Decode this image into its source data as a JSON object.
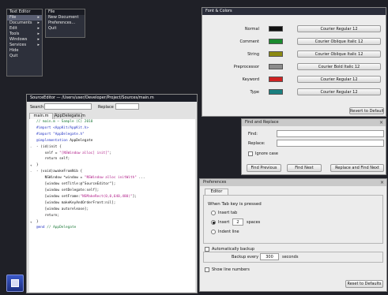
{
  "menus": {
    "root": {
      "title": "Text Editor",
      "items": [
        {
          "label": "File",
          "selected": true
        },
        {
          "label": "Documents"
        },
        {
          "label": "Edit"
        },
        {
          "label": "Tools"
        },
        {
          "label": "Windows"
        },
        {
          "label": "Services"
        },
        {
          "label": "Hide"
        },
        {
          "label": "Quit"
        }
      ]
    },
    "file": {
      "title": "File",
      "items": [
        {
          "label": "New Document"
        },
        {
          "label": "Preferences..."
        },
        {
          "label": "Quit"
        }
      ]
    }
  },
  "font_colors": {
    "title": "Font & Colors",
    "rows": [
      {
        "label": "Normal",
        "color": "#111111",
        "button": "Courier Regular 12"
      },
      {
        "label": "Comment",
        "color": "#1a8a2e",
        "button": "Courier Oblique Italic 12"
      },
      {
        "label": "String",
        "color": "#8c8a12",
        "button": "Courier Oblique Italic 12"
      },
      {
        "label": "Preprocessor",
        "color": "#8c8c8c",
        "button": "Courier Bold Italic 12"
      },
      {
        "label": "Keyword",
        "color": "#cf2222",
        "button": "Courier Regular 12"
      },
      {
        "label": "Type",
        "color": "#1a7f7f",
        "button": "Courier Regular 12"
      }
    ],
    "revert_label": "Revert to Default"
  },
  "editor": {
    "title": "SourceEditor — /Users/user/Developer/Project/Sources/main.m",
    "search_label": "Search",
    "replace_label": "Replace",
    "tabs": [
      "main.m",
      "AppDelegate.m"
    ],
    "lines": [
      {
        "parts": [
          {
            "t": "// main.m — Sample (C) 2010",
            "c": "cm"
          }
        ]
      },
      {
        "parts": [
          {
            "t": ""
          }
        ]
      },
      {
        "parts": [
          {
            "t": "#import <AppKit/AppKit.h>",
            "c": "kw"
          }
        ]
      },
      {
        "parts": [
          {
            "t": "#import \"AppDelegate.h\"",
            "c": "kw"
          }
        ]
      },
      {
        "parts": [
          {
            "t": ""
          }
        ]
      },
      {
        "parts": [
          {
            "t": "@implementation ",
            "c": "kw"
          },
          {
            "t": "AppDelegate"
          }
        ]
      },
      {
        "parts": [
          {
            "t": ""
          }
        ]
      },
      {
        "fold": "-",
        "parts": [
          {
            "t": "- (id)init {"
          }
        ]
      },
      {
        "parts": [
          {
            "t": ""
          }
        ]
      },
      {
        "parts": [
          {
            "t": "    self = "
          },
          {
            "t": "\"[NSWindow alloc] init]\"",
            "c": "st"
          },
          {
            "t": ";"
          }
        ]
      },
      {
        "parts": [
          {
            "t": "    return self;"
          }
        ]
      },
      {
        "fold": "+",
        "parts": [
          {
            "t": "}"
          }
        ]
      },
      {
        "parts": [
          {
            "t": ""
          }
        ]
      },
      {
        "fold": "-",
        "parts": [
          {
            "t": "- (void)awakeFromNib {"
          }
        ]
      },
      {
        "parts": [
          {
            "t": ""
          }
        ]
      },
      {
        "parts": [
          {
            "t": "    NSWindow *window = "
          },
          {
            "t": "\"NSWindow alloc initWith\"",
            "c": "st"
          },
          {
            "t": " ..."
          }
        ]
      },
      {
        "parts": [
          {
            "t": ""
          }
        ]
      },
      {
        "parts": [
          {
            "t": "    [window setTitle:@\"SourceEditor\"];"
          }
        ]
      },
      {
        "parts": [
          {
            "t": "    [window setDelegate:self];"
          }
        ]
      },
      {
        "parts": [
          {
            "t": "    [window setFrame:"
          },
          {
            "t": "\"NSMakeRect(0,0,640,480)\"",
            "c": "st"
          },
          {
            "t": "];"
          }
        ]
      },
      {
        "parts": [
          {
            "t": "    [window makeKeyAndOrderFront:nil];"
          }
        ]
      },
      {
        "parts": [
          {
            "t": ""
          }
        ]
      },
      {
        "parts": [
          {
            "t": "    [window autorelease];"
          }
        ]
      },
      {
        "parts": [
          {
            "t": "    return;"
          }
        ]
      },
      {
        "fold": "+",
        "parts": [
          {
            "t": "}"
          }
        ]
      },
      {
        "parts": [
          {
            "t": ""
          }
        ]
      },
      {
        "parts": [
          {
            "t": "@end ",
            "c": "kw"
          },
          {
            "t": "// AppDelegate",
            "c": "cm"
          }
        ]
      }
    ]
  },
  "find_replace": {
    "title": "Find and Replace",
    "find_label": "Find:",
    "replace_label": "Replace:",
    "ignore_case": "Ignore case",
    "buttons": [
      "Find Previous",
      "Find Next",
      "Replace and Find Next"
    ]
  },
  "preferences": {
    "title": "Preferences",
    "tab": "Editor",
    "tab_label": "When Tab key is pressed",
    "opt_tab": "Insert tab",
    "opt_spaces_pre": "Insert",
    "opt_spaces_value": "2",
    "opt_spaces_post": "spaces",
    "opt_indent": "Indent line",
    "auto_backup": "Automatically backup",
    "backup_every_pre": "Backup every",
    "backup_every_value": "300",
    "backup_every_post": "seconds",
    "show_line_numbers": "Show line numbers",
    "reset_label": "Reset to Defaults"
  }
}
